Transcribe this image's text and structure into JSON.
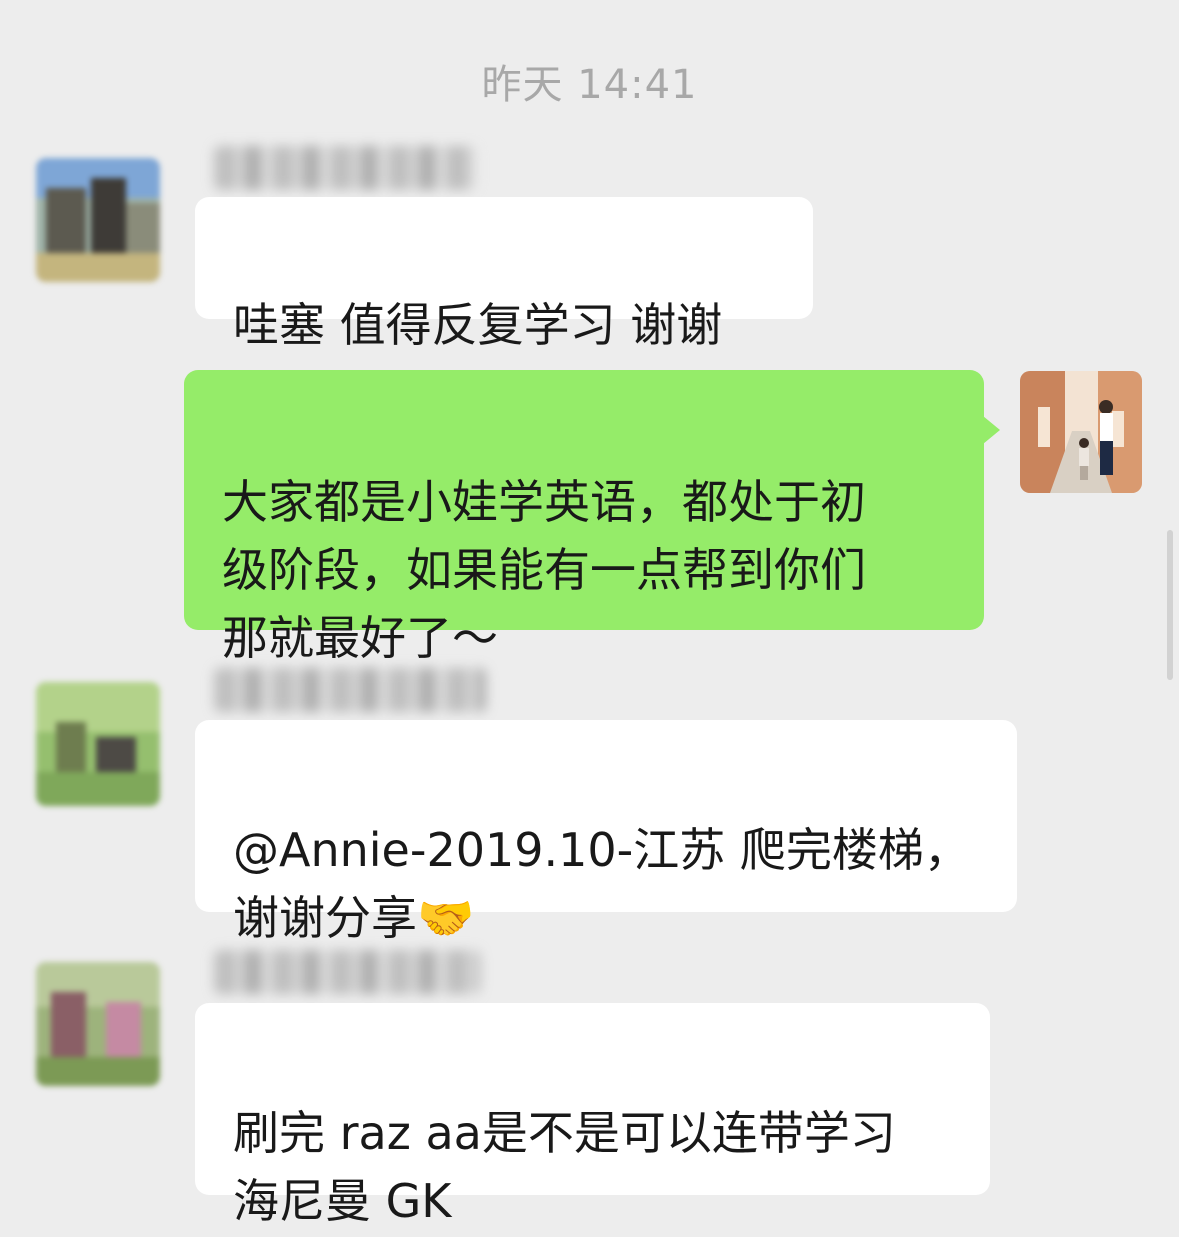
{
  "timestamp": "昨天 14:41",
  "messages": [
    {
      "direction": "incoming",
      "sender_name": "",
      "text": "哇塞 值得反复学习 谢谢"
    },
    {
      "direction": "outgoing",
      "text": "大家都是小娃学英语，都处于初\n级阶段，如果能有一点帮到你们\n那就最好了～"
    },
    {
      "direction": "incoming",
      "sender_name": "",
      "text": "@Annie-2019.10-江苏 爬完楼梯，\n谢谢分享",
      "emoji": "🤝"
    },
    {
      "direction": "incoming",
      "sender_name": "",
      "text": "刷完 raz aa是不是可以连带学习\n海尼曼 GK"
    }
  ],
  "colors": {
    "background": "#ededed",
    "incoming_bubble": "#ffffff",
    "outgoing_bubble": "#95ec69",
    "timestamp": "#a8a8a8"
  }
}
